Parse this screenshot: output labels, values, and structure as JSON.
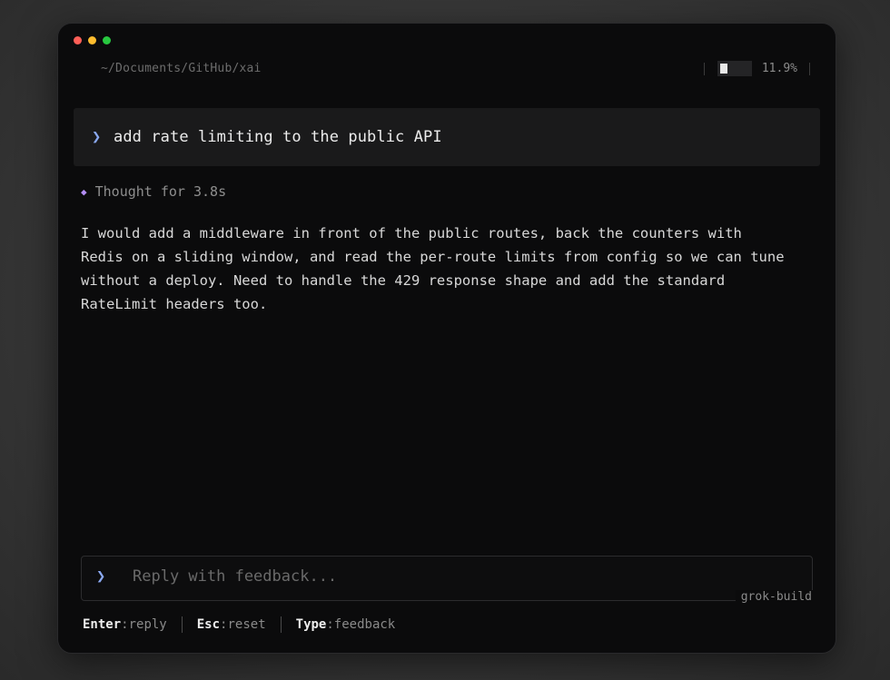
{
  "window": {
    "traffic_lights": [
      {
        "name": "close",
        "color": "#ff5f57"
      },
      {
        "name": "minimize",
        "color": "#febc2e"
      },
      {
        "name": "zoom",
        "color": "#28c840"
      }
    ],
    "path": "~/Documents/GitHub/xai",
    "context_usage": {
      "percent_label": "11.9%",
      "fraction": 0.119
    }
  },
  "conversation": {
    "prompt_icon": "chevron-right-icon",
    "user_prompt": "add rate limiting to the public API",
    "thought_icon": "diamond-icon",
    "thought_label": "Thought for 3.8s",
    "response": "I would add a middleware in front of the public routes, back the counters with\nRedis on a sliding window, and read the per-route limits from config so we can tune\nwithout a deploy. Need to handle the 429 response shape and add the standard\nRateLimit headers too."
  },
  "input": {
    "placeholder": "Reply with feedback...",
    "value": "",
    "model_tag": "grok-build"
  },
  "hints": [
    {
      "key": "Enter",
      "action": "reply"
    },
    {
      "key": "Esc",
      "action": "reset"
    },
    {
      "key": "Type",
      "action": "feedback"
    }
  ],
  "colors": {
    "accent_chevron": "#8aa8f0",
    "thought_diamond": "#b48ef5",
    "window_bg": "#0b0b0c"
  }
}
